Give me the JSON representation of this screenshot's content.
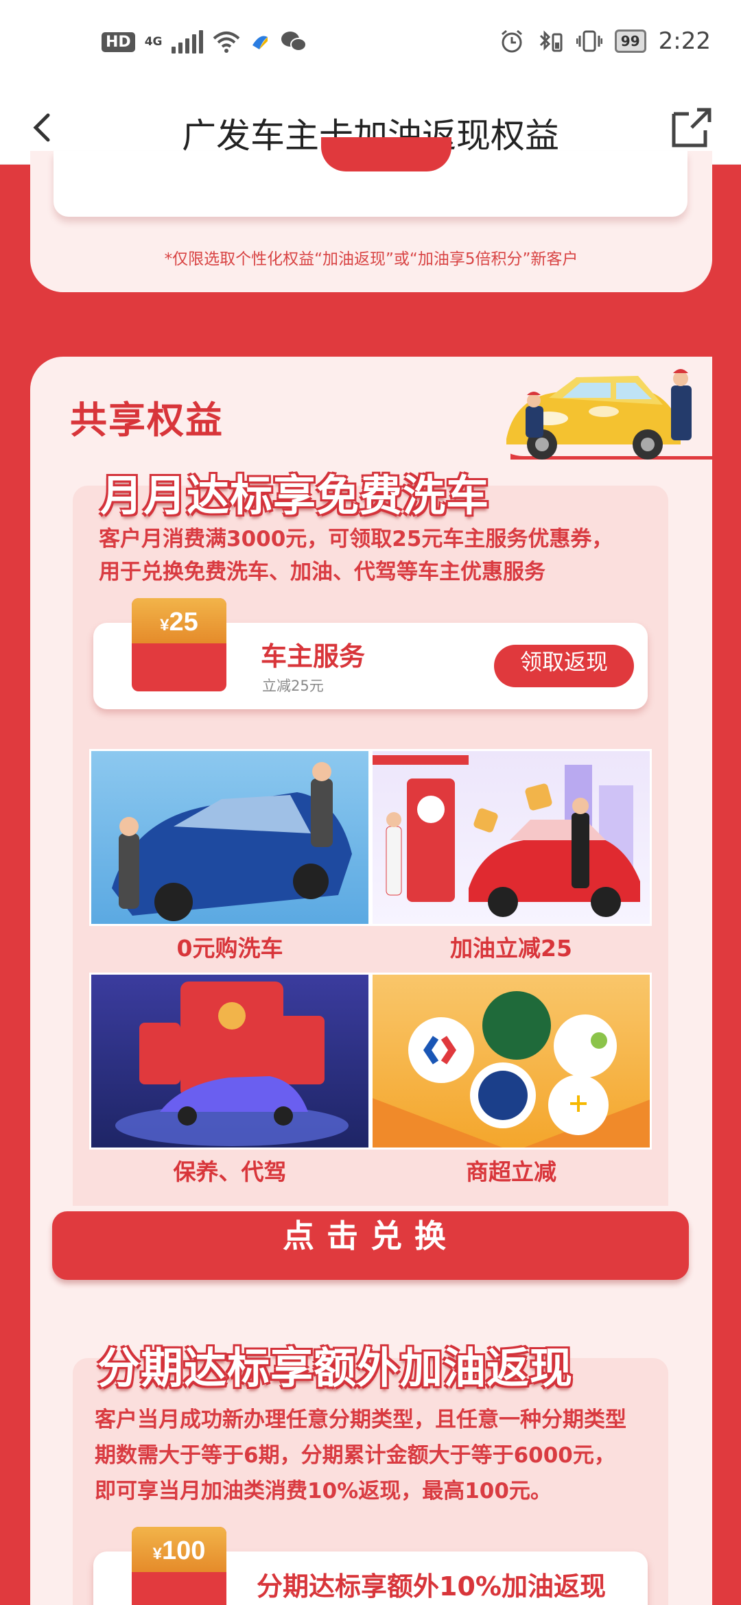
{
  "status_bar": {
    "left_badge": "HD",
    "network": "4G",
    "battery": "99",
    "time": "2:22"
  },
  "nav": {
    "title": "广发车主卡加油返现权益"
  },
  "top_card": {
    "note": "*仅限选取个性化权益“加油返现”或“加油享5倍积分”新客户"
  },
  "shared": {
    "title": "共享权益",
    "section1": {
      "title": "月月达标享免费洗车",
      "desc_line1": "客户月消费满3000元，可领取25元车主服务优惠券，",
      "desc_line2": "用于兑换免费洗车、加油、代驾等车主优惠服务",
      "coupon": {
        "currency": "¥",
        "value": "25",
        "title": "车主服务",
        "subtitle": "立减25元",
        "button": "领取返现"
      },
      "tiles": [
        {
          "label": "0元购洗车"
        },
        {
          "label": "加油立减25"
        },
        {
          "label": "保养、代驾"
        },
        {
          "label": "商超立减"
        }
      ],
      "cta": "点击兑换"
    },
    "section2": {
      "title": "分期达标享额外加油返现",
      "desc_line1": "客户当月成功新办理任意分期类型，且任意一种分期类型",
      "desc_line2": "期数需大于等于6期，分期累计金额大于等于6000元，",
      "desc_line3": "即可享当月加油类消费10%返现，最高100元。",
      "coupon": {
        "currency": "¥",
        "value": "100",
        "title": "分期达标享额外10%加油返现"
      }
    }
  },
  "colors": {
    "brand_red": "#e03a3e",
    "panel_pink": "#fdeeed",
    "text_red": "#d8353a"
  }
}
